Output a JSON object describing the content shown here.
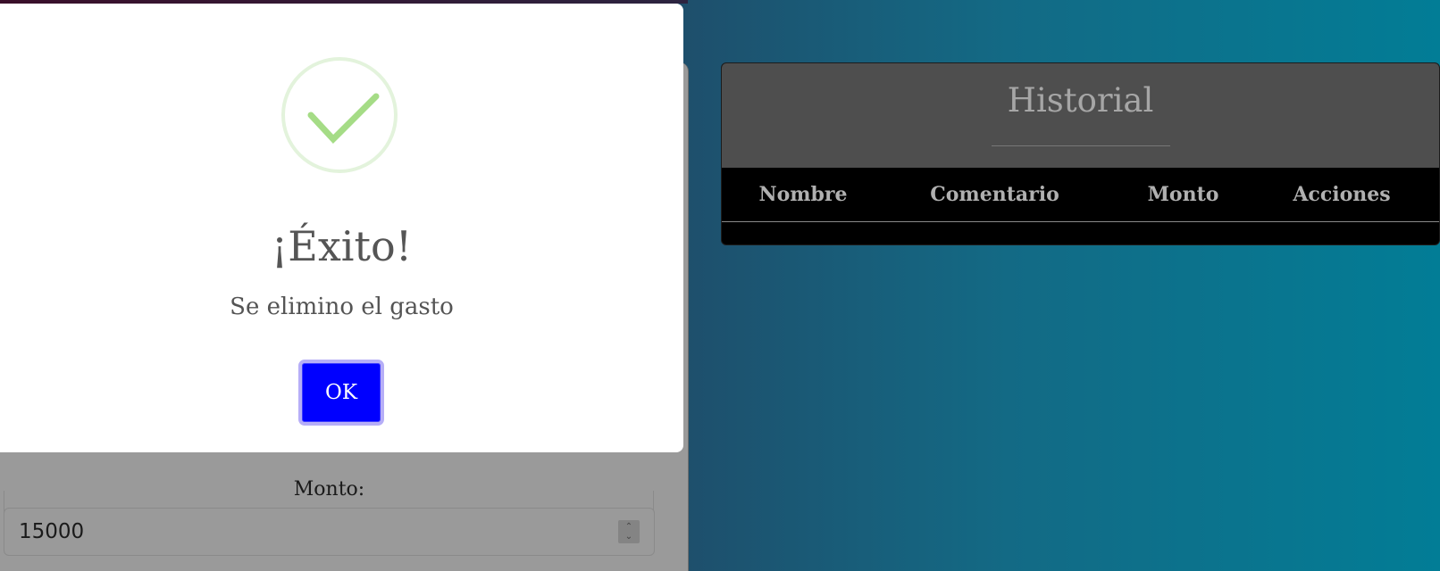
{
  "form": {
    "monto_label": "Monto:",
    "monto_value": "15000"
  },
  "historial": {
    "title": "Historial",
    "columns": [
      "Nombre",
      "Comentario",
      "Monto",
      "Acciones"
    ]
  },
  "modal": {
    "icon": "check-circle-icon",
    "title": "¡Éxito!",
    "message": "Se elimino el gasto",
    "ok_label": "OK",
    "colors": {
      "button": "#0000ff",
      "button_focus_ring": "#b6aef7",
      "check": "#a5dc86"
    }
  }
}
